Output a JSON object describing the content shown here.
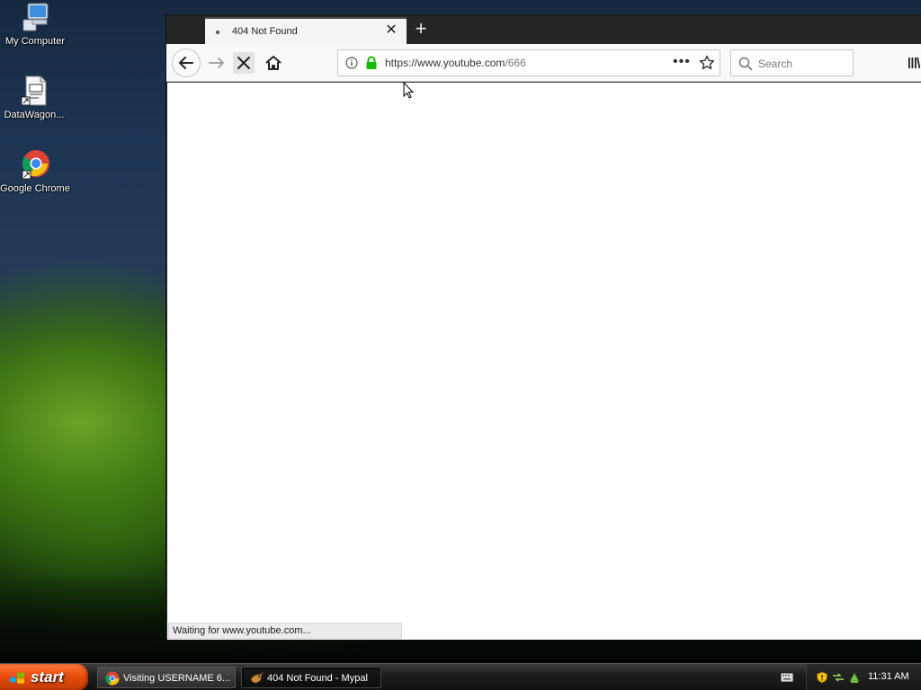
{
  "desktop": {
    "icons": [
      {
        "label": "My Computer",
        "icon": "computer-icon"
      },
      {
        "label": "DataWagon...",
        "icon": "file-shortcut-icon"
      },
      {
        "label": "Google Chrome",
        "icon": "chrome-icon"
      }
    ]
  },
  "browser": {
    "tab": {
      "title": "404 Not Found"
    },
    "new_tab_label": "+",
    "close_label": "✕",
    "url": {
      "main": "https://www.youtube.com",
      "path": "/666"
    },
    "page_actions": "•••",
    "search": {
      "placeholder": "Search"
    },
    "status": "Waiting for www.youtube.com..."
  },
  "taskbar": {
    "start_label": "start",
    "tasks": [
      {
        "label": "Visiting USERNAME 6...",
        "icon": "chrome-icon"
      },
      {
        "label": "404 Not Found - Mypal",
        "icon": "mypal-icon",
        "active": true
      }
    ],
    "clock": "11:31 AM"
  },
  "colors": {
    "start_orange": "#e84d0e",
    "lock_green": "#12bc00"
  }
}
